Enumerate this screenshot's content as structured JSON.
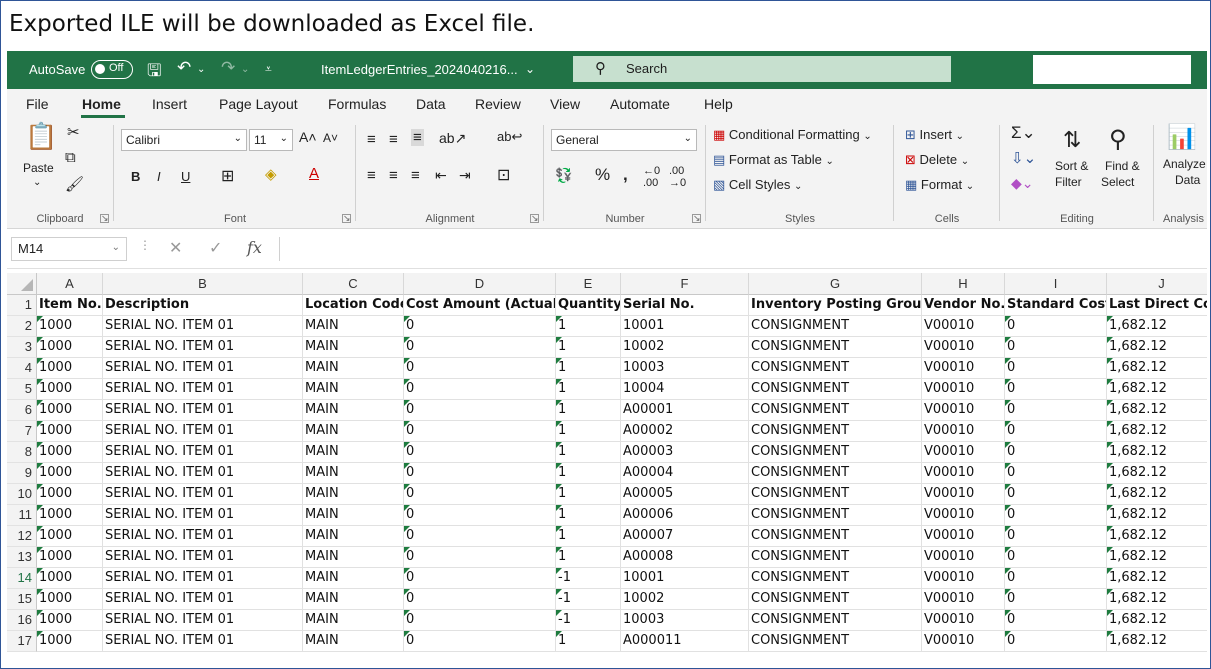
{
  "caption": "Exported ILE will be downloaded as Excel file.",
  "titlebar": {
    "autosave_label": "AutoSave",
    "autosave_state": "Off",
    "doc_name": "ItemLedgerEntries_2024040216...",
    "search_placeholder": "Search"
  },
  "tabs": [
    "File",
    "Home",
    "Insert",
    "Page Layout",
    "Formulas",
    "Data",
    "Review",
    "View",
    "Automate",
    "Help"
  ],
  "active_tab": "Home",
  "ribbon": {
    "clipboard": {
      "label": "Clipboard",
      "paste": "Paste"
    },
    "font": {
      "label": "Font",
      "family": "Calibri",
      "size": "11",
      "bold": "B",
      "italic": "I",
      "underline": "U"
    },
    "alignment": {
      "label": "Alignment"
    },
    "number": {
      "label": "Number",
      "format": "General"
    },
    "styles": {
      "label": "Styles",
      "conditional": "Conditional Formatting",
      "format_table": "Format as Table",
      "cell_styles": "Cell Styles"
    },
    "cells": {
      "label": "Cells",
      "insert": "Insert",
      "delete": "Delete",
      "format": "Format"
    },
    "editing": {
      "label": "Editing",
      "sort_filter_1": "Sort &",
      "sort_filter_2": "Filter",
      "find_select_1": "Find &",
      "find_select_2": "Select"
    },
    "analysis": {
      "label": "Analysis",
      "analyze_1": "Analyze",
      "analyze_2": "Data"
    }
  },
  "formula_bar": {
    "name_box": "M14",
    "fx": "fx"
  },
  "grid": {
    "columns": [
      "A",
      "B",
      "C",
      "D",
      "E",
      "F",
      "G",
      "H",
      "I",
      "J"
    ],
    "headers": [
      "Item No.",
      "Description",
      "Location Code",
      "Cost Amount (Actual)",
      "Quantity",
      "Serial No.",
      "Inventory Posting Group",
      "Vendor No.",
      "Standard Cost",
      "Last Direct Cost"
    ],
    "selected_row": 14,
    "rows": [
      [
        "1000",
        "SERIAL NO. ITEM 01",
        "MAIN",
        "0",
        "1",
        "10001",
        "CONSIGNMENT",
        "V00010",
        "0",
        "1,682.12"
      ],
      [
        "1000",
        "SERIAL NO. ITEM 01",
        "MAIN",
        "0",
        "1",
        "10002",
        "CONSIGNMENT",
        "V00010",
        "0",
        "1,682.12"
      ],
      [
        "1000",
        "SERIAL NO. ITEM 01",
        "MAIN",
        "0",
        "1",
        "10003",
        "CONSIGNMENT",
        "V00010",
        "0",
        "1,682.12"
      ],
      [
        "1000",
        "SERIAL NO. ITEM 01",
        "MAIN",
        "0",
        "1",
        "10004",
        "CONSIGNMENT",
        "V00010",
        "0",
        "1,682.12"
      ],
      [
        "1000",
        "SERIAL NO. ITEM 01",
        "MAIN",
        "0",
        "1",
        "A00001",
        "CONSIGNMENT",
        "V00010",
        "0",
        "1,682.12"
      ],
      [
        "1000",
        "SERIAL NO. ITEM 01",
        "MAIN",
        "0",
        "1",
        "A00002",
        "CONSIGNMENT",
        "V00010",
        "0",
        "1,682.12"
      ],
      [
        "1000",
        "SERIAL NO. ITEM 01",
        "MAIN",
        "0",
        "1",
        "A00003",
        "CONSIGNMENT",
        "V00010",
        "0",
        "1,682.12"
      ],
      [
        "1000",
        "SERIAL NO. ITEM 01",
        "MAIN",
        "0",
        "1",
        "A00004",
        "CONSIGNMENT",
        "V00010",
        "0",
        "1,682.12"
      ],
      [
        "1000",
        "SERIAL NO. ITEM 01",
        "MAIN",
        "0",
        "1",
        "A00005",
        "CONSIGNMENT",
        "V00010",
        "0",
        "1,682.12"
      ],
      [
        "1000",
        "SERIAL NO. ITEM 01",
        "MAIN",
        "0",
        "1",
        "A00006",
        "CONSIGNMENT",
        "V00010",
        "0",
        "1,682.12"
      ],
      [
        "1000",
        "SERIAL NO. ITEM 01",
        "MAIN",
        "0",
        "1",
        "A00007",
        "CONSIGNMENT",
        "V00010",
        "0",
        "1,682.12"
      ],
      [
        "1000",
        "SERIAL NO. ITEM 01",
        "MAIN",
        "0",
        "1",
        "A00008",
        "CONSIGNMENT",
        "V00010",
        "0",
        "1,682.12"
      ],
      [
        "1000",
        "SERIAL NO. ITEM 01",
        "MAIN",
        "0",
        "-1",
        "10001",
        "CONSIGNMENT",
        "V00010",
        "0",
        "1,682.12"
      ],
      [
        "1000",
        "SERIAL NO. ITEM 01",
        "MAIN",
        "0",
        "-1",
        "10002",
        "CONSIGNMENT",
        "V00010",
        "0",
        "1,682.12"
      ],
      [
        "1000",
        "SERIAL NO. ITEM 01",
        "MAIN",
        "0",
        "-1",
        "10003",
        "CONSIGNMENT",
        "V00010",
        "0",
        "1,682.12"
      ],
      [
        "1000",
        "SERIAL NO. ITEM 01",
        "MAIN",
        "0",
        "1",
        "A000011",
        "CONSIGNMENT",
        "V00010",
        "0",
        "1,682.12"
      ]
    ]
  },
  "colors": {
    "excel_green": "#217346",
    "ribbon_bg": "#f3f3f3",
    "search_bg": "#c7e0cf",
    "text_triangle": "#1e7c3f"
  }
}
